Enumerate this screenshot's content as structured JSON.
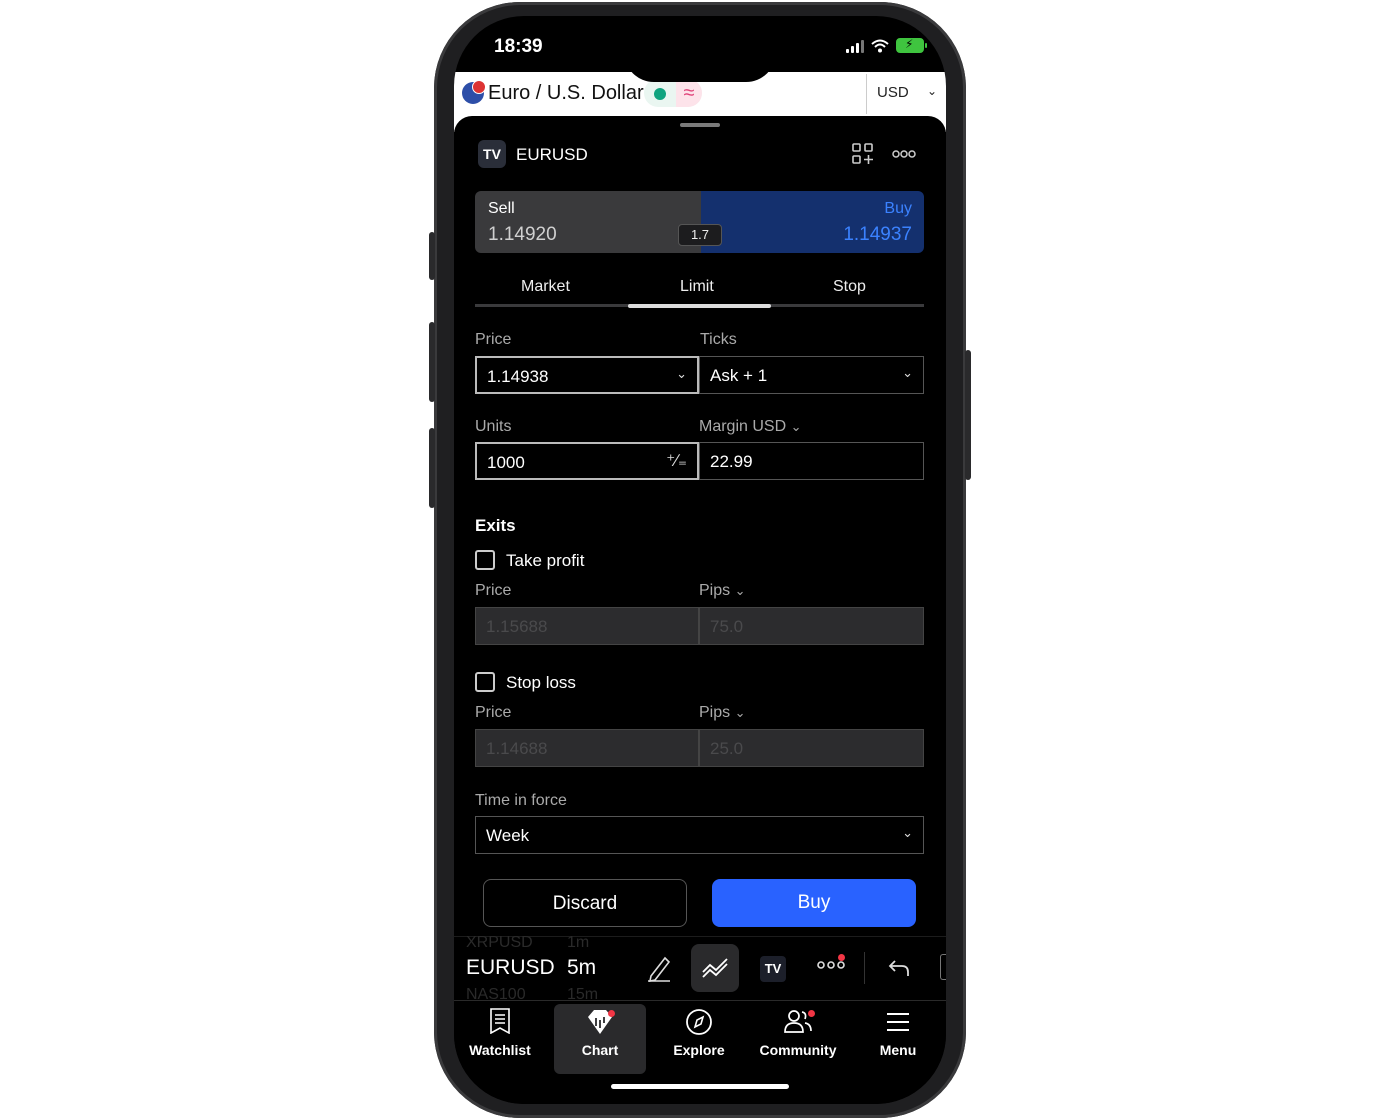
{
  "status_bar": {
    "time": "18:39"
  },
  "web_header": {
    "title": "Euro / U.S. Dollar",
    "wave_symbol": "≈",
    "currency": "USD"
  },
  "order_panel": {
    "symbol": "EURUSD",
    "logo": "TV",
    "sell": {
      "label": "Sell",
      "price": "1.14920"
    },
    "buy": {
      "label": "Buy",
      "price": "1.14937"
    },
    "spread": "1.7",
    "tabs": [
      {
        "label": "Market"
      },
      {
        "label": "Limit",
        "active": true
      },
      {
        "label": "Stop"
      }
    ],
    "price_label": "Price",
    "price_value": "1.14938",
    "ticks_label": "Ticks",
    "ticks_value": "Ask + 1",
    "units_label": "Units",
    "units_value": "1000",
    "margin_label": "Margin USD",
    "margin_value": "22.99",
    "exits_title": "Exits",
    "take_profit": {
      "label": "Take profit",
      "price_label": "Price",
      "pips_label": "Pips",
      "price_value": "1.15688",
      "pips_value": "75.0"
    },
    "stop_loss": {
      "label": "Stop loss",
      "price_label": "Price",
      "pips_label": "Pips",
      "price_value": "1.14688",
      "pips_value": "25.0"
    },
    "time_in_force_label": "Time in force",
    "time_in_force_value": "Week",
    "discard_label": "Discard",
    "buy_label": "Buy"
  },
  "toolbar": {
    "symbol": "EURUSD",
    "interval": "5m",
    "ghost_top_symbol": "XRPUSD",
    "ghost_top_interval": "1m",
    "ghost_bottom_symbol": "NAS100",
    "ghost_bottom_interval": "15m",
    "logo": "TV"
  },
  "bottom_nav": [
    {
      "label": "Watchlist",
      "icon": "watchlist-icon"
    },
    {
      "label": "Chart",
      "icon": "chart-icon",
      "active": true
    },
    {
      "label": "Explore",
      "icon": "compass-icon"
    },
    {
      "label": "Community",
      "icon": "community-icon"
    },
    {
      "label": "Menu",
      "icon": "menu-icon"
    }
  ],
  "colors": {
    "buy_blue": "#2962ff",
    "buy_panel": "#14306e",
    "alert_red": "#f23645"
  }
}
